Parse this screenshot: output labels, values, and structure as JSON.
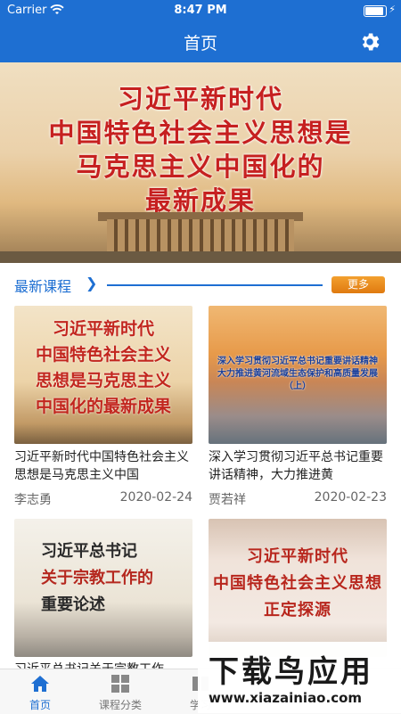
{
  "status_bar": {
    "carrier": "Carrier",
    "time": "8:47 PM"
  },
  "nav": {
    "title": "首页",
    "settings_icon": "gear-icon"
  },
  "banner": {
    "lines": [
      "习近平新时代",
      "中国特色社会主义思想是",
      "马克思主义中国化的",
      "最新成果"
    ]
  },
  "section": {
    "label": "最新课程",
    "more_label": "更多"
  },
  "courses": [
    {
      "thumb_lines": [
        "习近平新时代",
        "中国特色社会主义",
        "思想是马克思主义",
        "中国化的最新成果"
      ],
      "title": "习近平新时代中国特色社会主义思想是马克思主义中国",
      "author": "李志勇",
      "date": "2020-02-24"
    },
    {
      "thumb_lines": [
        "深入学习贯彻习近平总书记重要讲话精神",
        "大力推进黄河流域生态保护和高质量发展",
        "（上）"
      ],
      "title": "深入学习贯彻习近平总书记重要讲话精神，大力推进黄",
      "author": "贾若祥",
      "date": "2020-02-23"
    },
    {
      "thumb_lines": [
        "习近平总书记",
        "关于宗教工作的",
        "重要论述"
      ],
      "title": "习近平总书记关于宗教工作",
      "author": "",
      "date": ""
    },
    {
      "thumb_lines": [
        "习近平新时代",
        "中国特色社会主义思想",
        "正定探源"
      ],
      "title": "",
      "author": "",
      "date": ""
    }
  ],
  "tabs": [
    {
      "label": "首页",
      "icon": "home-icon",
      "active": true
    },
    {
      "label": "课程分类",
      "icon": "grid-icon",
      "active": false
    },
    {
      "label": "学习",
      "icon": "book-icon",
      "active": false
    }
  ],
  "watermark": {
    "title": "下载鸟应用",
    "url": "www.xiazainiao.com"
  },
  "colors": {
    "primary": "#1e6fd2",
    "accent": "#e98a1c",
    "headline_red": "#c62020"
  }
}
